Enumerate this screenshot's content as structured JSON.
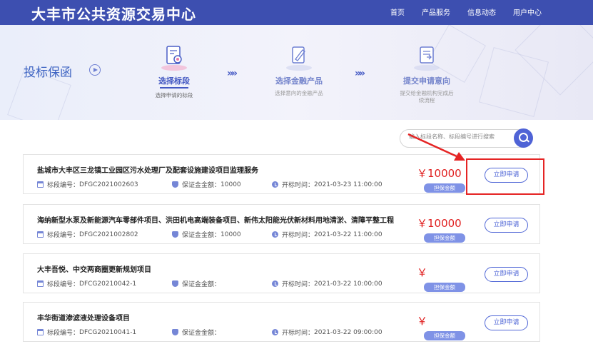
{
  "header": {
    "site_title": "大丰市公共资源交易中心",
    "nav": [
      "首页",
      "产品服务",
      "信息动态",
      "用户中心"
    ]
  },
  "banner": {
    "title": "投标保函",
    "steps": [
      {
        "name": "选择标段",
        "sub": "选择申请的标段"
      },
      {
        "name": "选择金融产品",
        "sub": "选择意向的金融产品"
      },
      {
        "name": "提交申请意向",
        "sub": "提交给金融机构完成后续流程"
      }
    ],
    "chevron": "»»"
  },
  "search": {
    "placeholder": "输入标段名称、标段编号进行搜索"
  },
  "labels": {
    "code": "标段编号：",
    "deposit": "保证金金额：",
    "open_time": "开标时间：",
    "tag": "担保金额",
    "apply": "立即申请"
  },
  "projects": [
    {
      "title": "盐城市大丰区三龙镇工业园区污水处理厂及配套设施建设项目监理服务",
      "code": "DFGC2021002603",
      "deposit": "10000",
      "open_time": "2021-03-23 11:00:00",
      "price": "￥10000"
    },
    {
      "title": "海纳新型水泵及新能源汽车零部件项目、洪田机电高端装备项目、新伟太阳能光伏新材料用地清淤、清障平整工程",
      "code": "DFGC2021002802",
      "deposit": "10000",
      "open_time": "2021-03-22 11:00:00",
      "price": "￥10000"
    },
    {
      "title": "大丰吾悦、中交两商圈更新规划项目",
      "code": "DFCG20210042-1",
      "deposit": "",
      "open_time": "2021-03-22 10:00:00",
      "price": "￥"
    },
    {
      "title": "丰华街道渗滤液处理设备项目",
      "code": "DFCG20210041-1",
      "deposit": "",
      "open_time": "2021-03-22 09:00:00",
      "price": "￥"
    }
  ],
  "colors": {
    "header_bg": "#3d4fb0",
    "accent": "#4f66d6",
    "price": "#e02020",
    "annotation": "#e52424"
  }
}
